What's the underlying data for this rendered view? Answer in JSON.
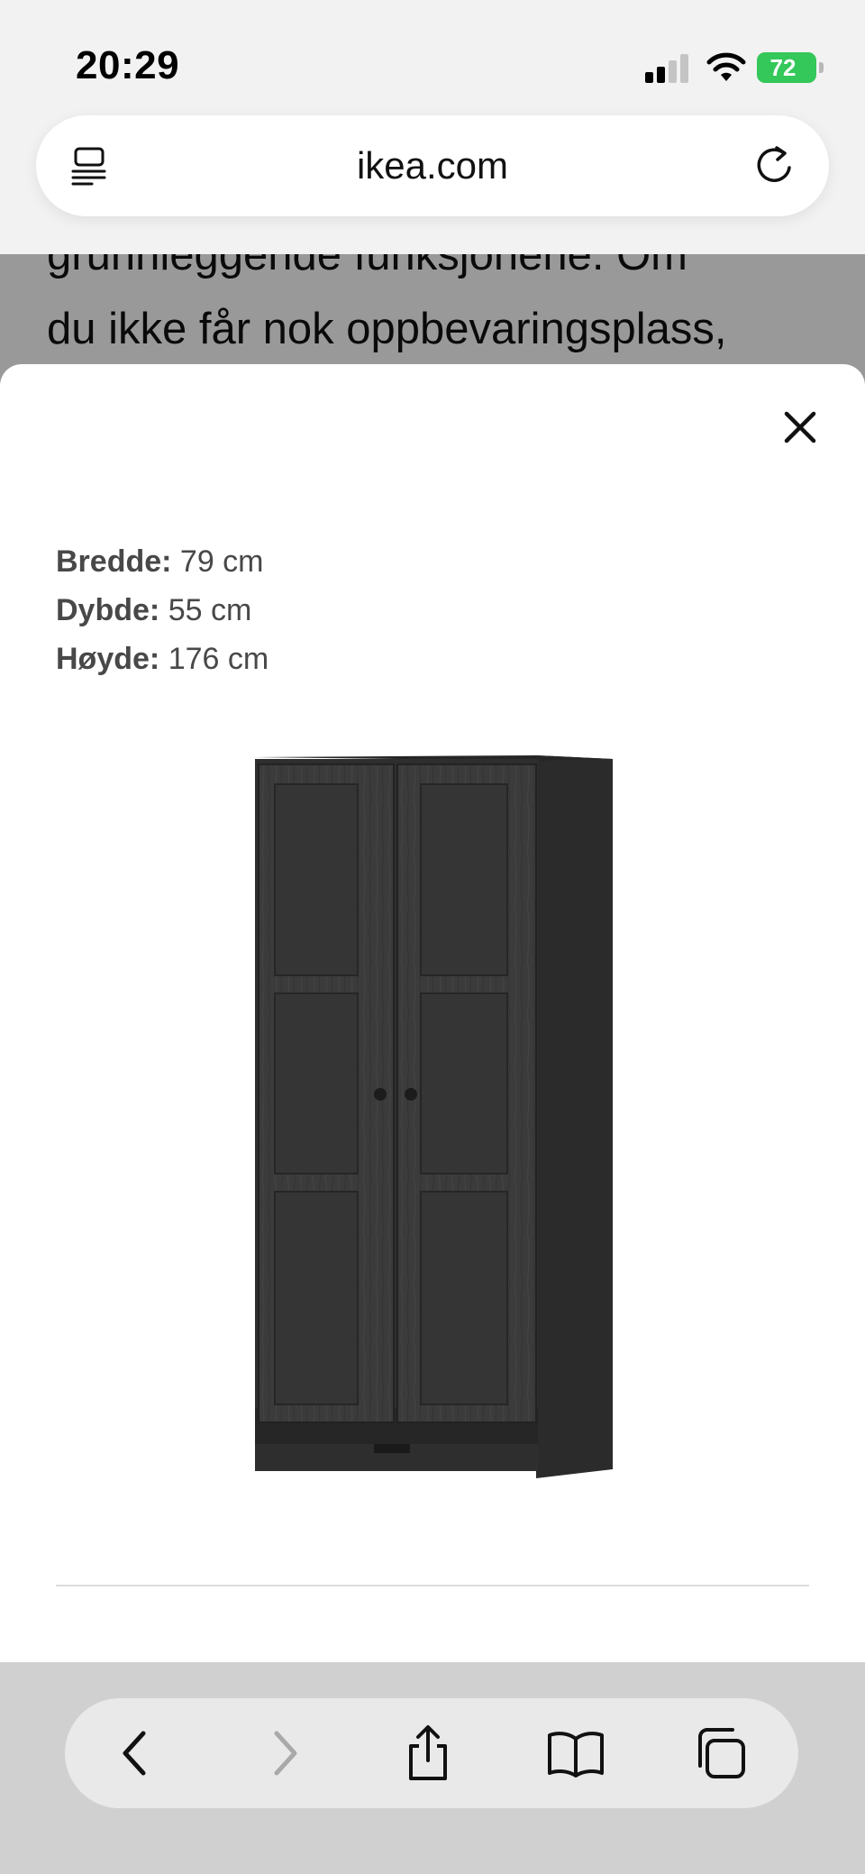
{
  "status_bar": {
    "time": "20:29",
    "battery": "72",
    "icons": [
      "signal-icon",
      "wifi-icon",
      "battery-icon"
    ]
  },
  "browser": {
    "url": "ikea.com",
    "icons": [
      "reader-icon",
      "reload-icon"
    ]
  },
  "background_page": {
    "lines": [
      "grunnleggende funksjonene. Om",
      "du ikke får nok oppbevaringsplass,"
    ]
  },
  "dimensions_modal": {
    "close_icon": "close-icon",
    "rows": [
      {
        "label": "Bredde:",
        "value": "79 cm"
      },
      {
        "label": "Dybde:",
        "value": "55 cm"
      },
      {
        "label": "Høyde:",
        "value": "176 cm"
      }
    ],
    "product_color": "#3a3a3a"
  },
  "toolbar": {
    "icons": [
      "back-icon",
      "forward-icon",
      "share-icon",
      "bookmarks-icon",
      "tabs-icon"
    ]
  },
  "colors": {
    "battery": "#34c759",
    "dim_overlay": "rgba(0,0,0,0.40)"
  }
}
